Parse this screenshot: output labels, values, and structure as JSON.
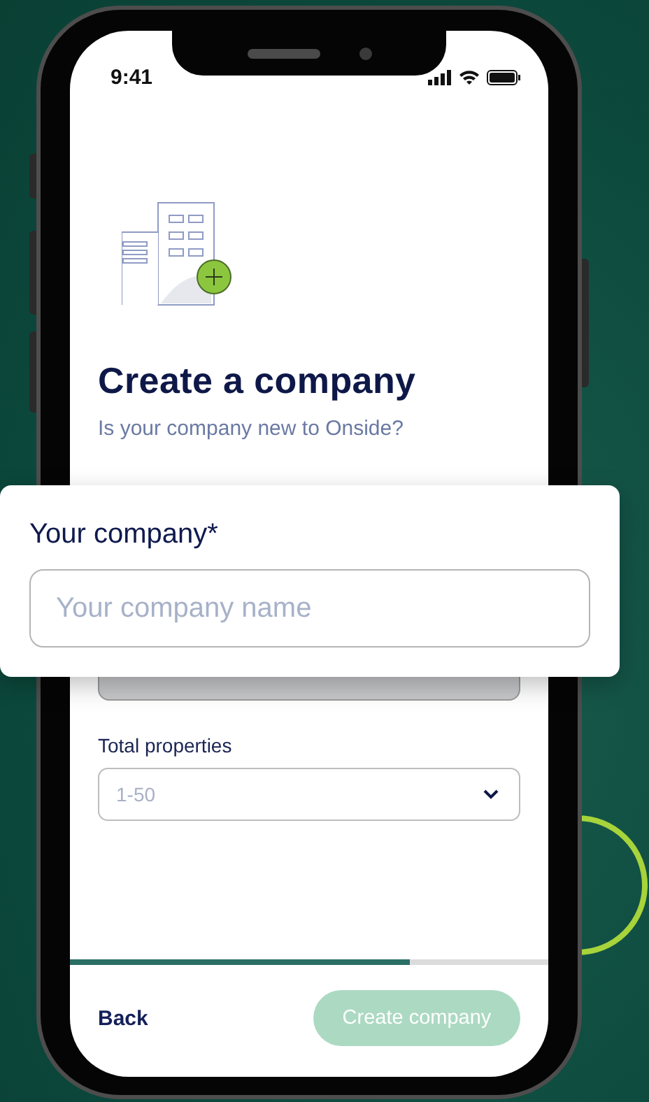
{
  "status_bar": {
    "time": "9:41"
  },
  "title": "Create a company",
  "subtitle": "Is your company new to Onside?",
  "company_field": {
    "label": "Your company*",
    "placeholder": "Your company name"
  },
  "properties_field": {
    "label": "Total properties",
    "placeholder": "1-50"
  },
  "progress": {
    "level": 0.71
  },
  "footer": {
    "back": {
      "label": "Back"
    },
    "create": {
      "label": "Create company",
      "disabled": true
    }
  }
}
